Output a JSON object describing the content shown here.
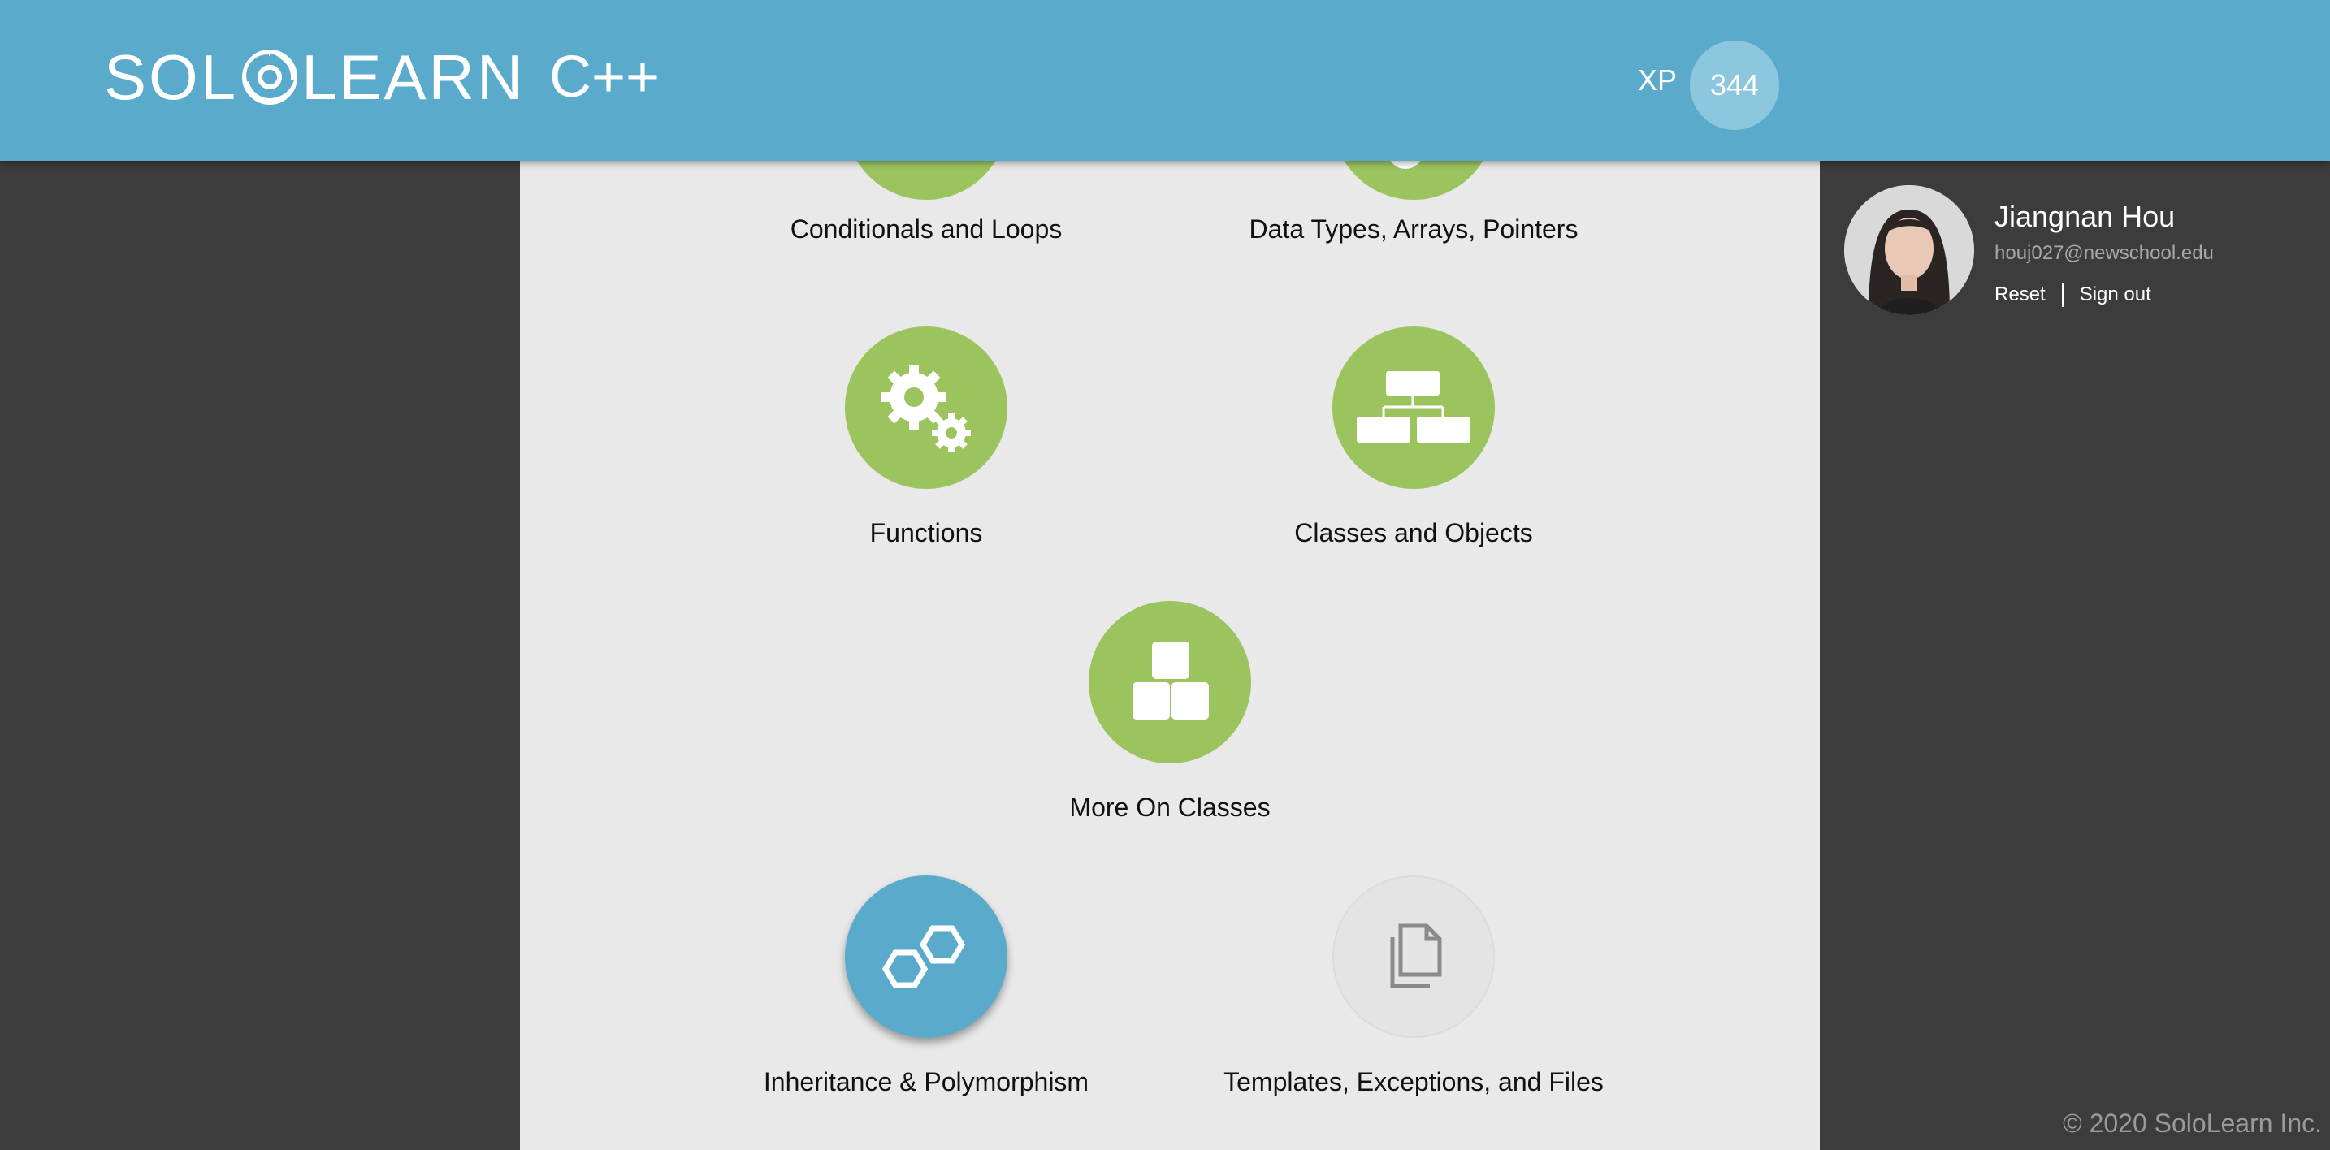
{
  "header": {
    "logo_text_left": "SOL",
    "logo_text_right": "LEARN",
    "course_title": "C++",
    "xp_label": "XP",
    "xp_value": "344"
  },
  "colors": {
    "header_bg": "#5aabcb",
    "completed_lesson": "#9bc45f",
    "active_lesson": "#5aabcb",
    "locked_lesson": "#e4e4e4",
    "sidebar_bg": "#3c3c3c"
  },
  "lessons": [
    {
      "label": "Conditionals and Loops",
      "icon": "loop-icon",
      "state": "completed"
    },
    {
      "label": "Data Types, Arrays, Pointers",
      "icon": "data-types-icon",
      "state": "completed"
    },
    {
      "label": "Functions",
      "icon": "gears-icon",
      "state": "completed"
    },
    {
      "label": "Classes and Objects",
      "icon": "hierarchy-icon",
      "state": "completed"
    },
    {
      "label": "More On Classes",
      "icon": "blocks-icon",
      "state": "completed"
    },
    {
      "label": "Inheritance & Polymorphism",
      "icon": "hexagons-icon",
      "state": "active"
    },
    {
      "label": "Templates, Exceptions, and Files",
      "icon": "documents-icon",
      "state": "locked"
    }
  ],
  "user": {
    "name": "Jiangnan Hou",
    "email": "houj027@newschool.edu",
    "reset_label": "Reset",
    "signout_label": "Sign out"
  },
  "footer": {
    "copyright": "© 2020 SoloLearn Inc."
  }
}
